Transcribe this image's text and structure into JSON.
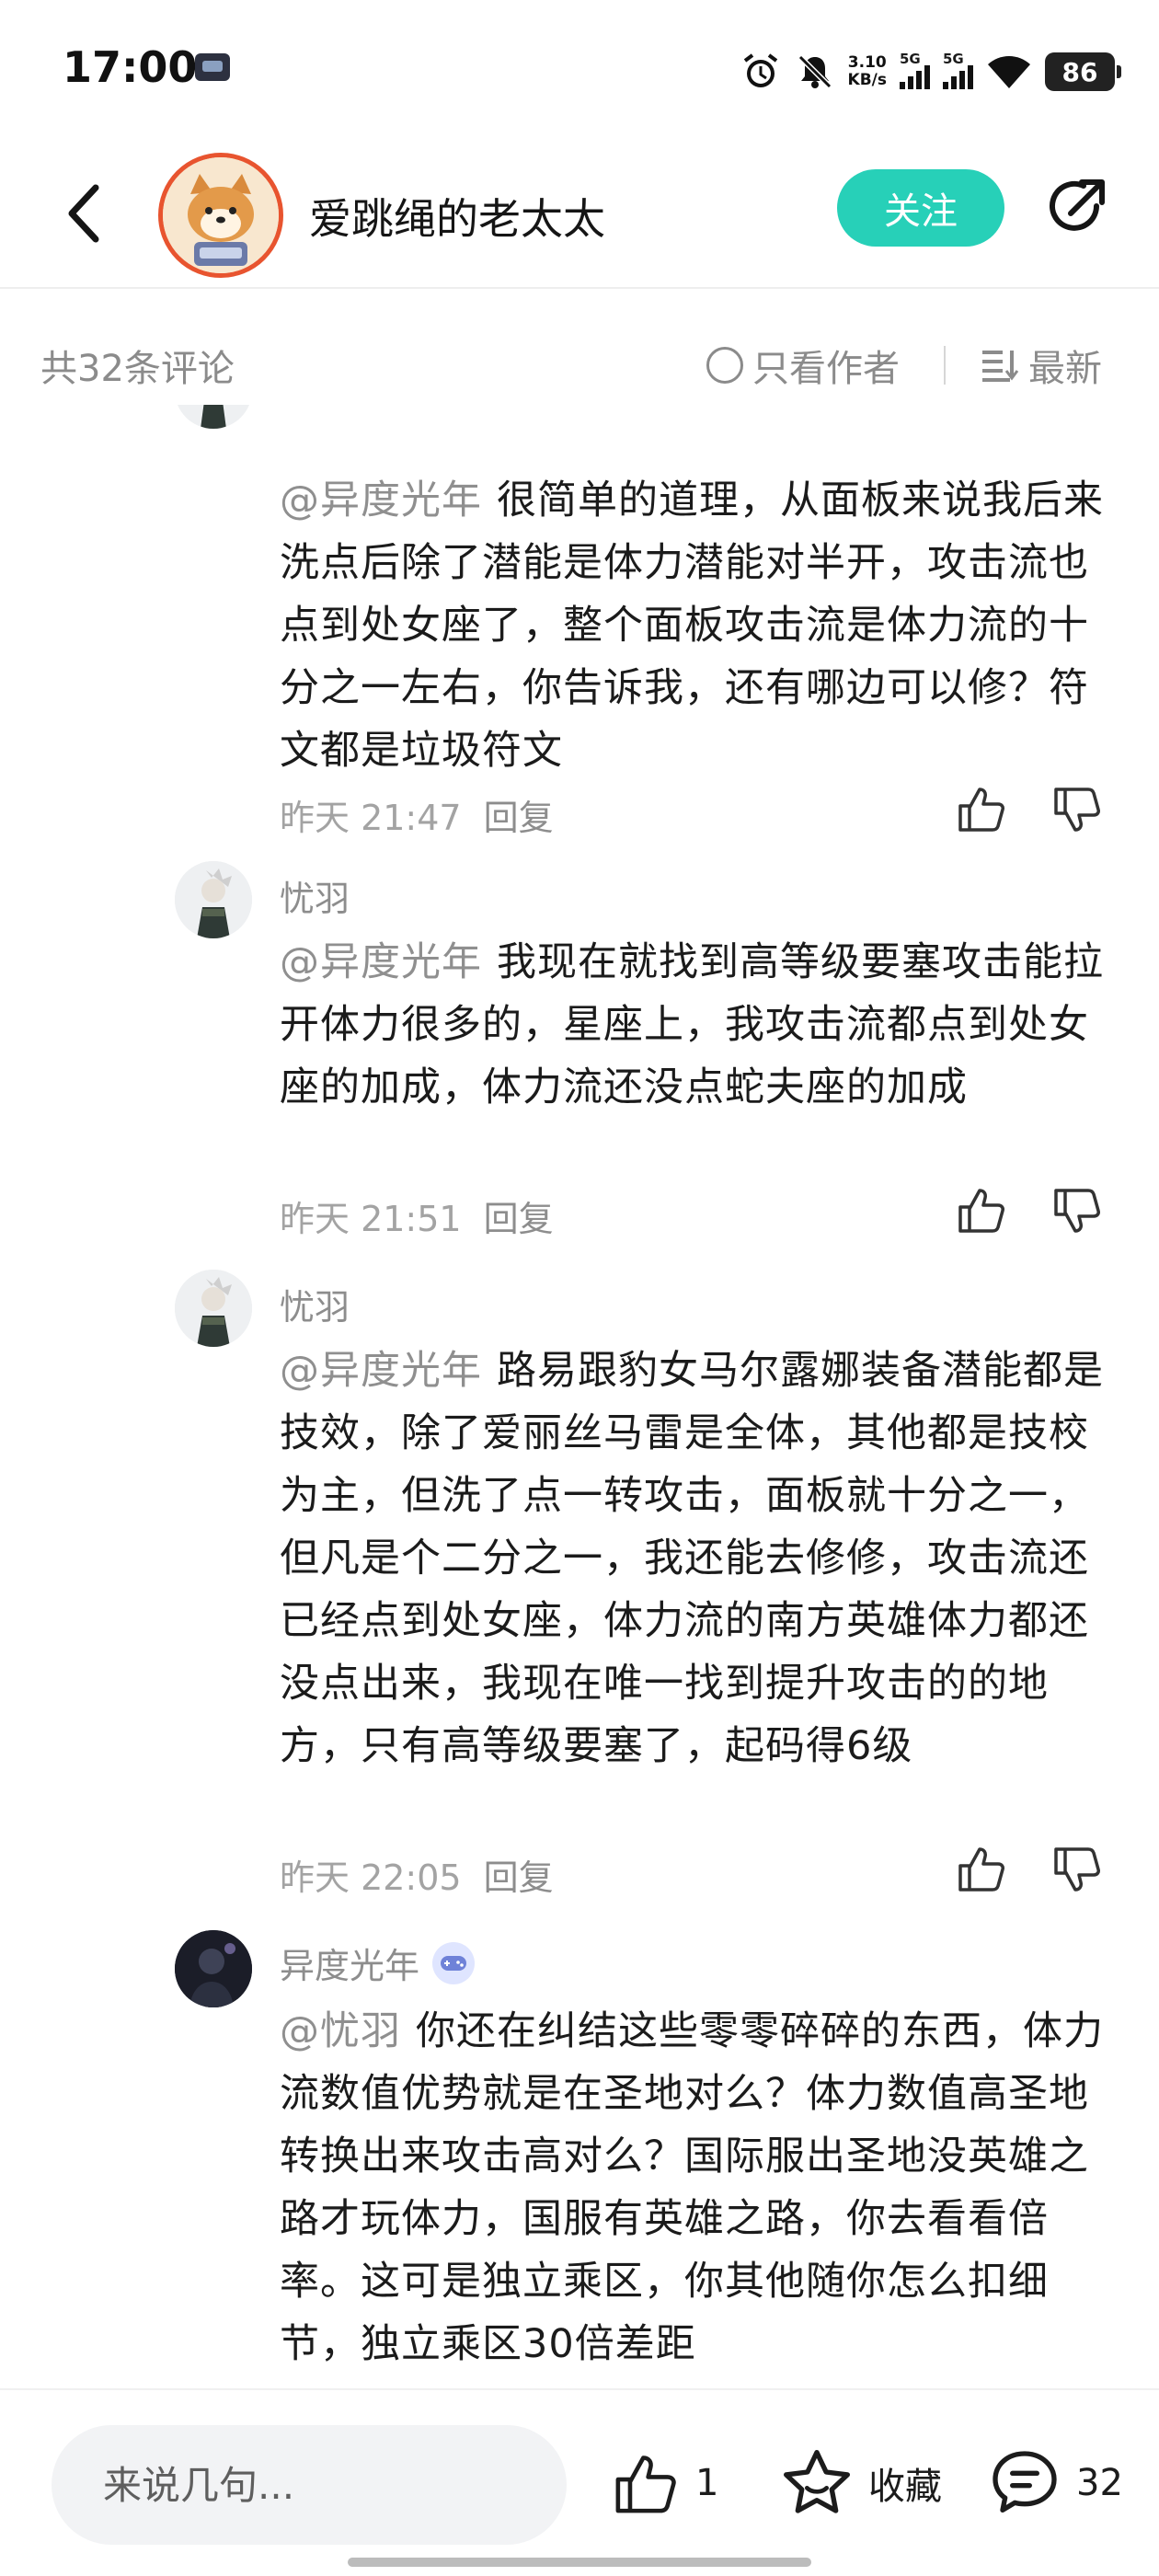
{
  "status_bar": {
    "time": "17:00",
    "net_speed_value": "3.10",
    "net_speed_unit": "KB/s",
    "signal_1_label": "5G",
    "signal_2_label": "5G",
    "battery": "86"
  },
  "header": {
    "title": "爱跳绳的老太太",
    "follow_label": "关注"
  },
  "filter": {
    "count_text": "共32条评论",
    "author_only_label": "只看作者",
    "sort_label": "最新"
  },
  "comments": [
    {
      "name": "",
      "mention": "@异度光年",
      "text": "很简单的道理，从面板来说我后来洗点后除了潜能是体力潜能对半开，攻击流也点到处女座了，整个面板攻击流是体力流的十分之一左右，你告诉我，还有哪边可以修？符文都是垃圾符文",
      "time": "昨天 21:47",
      "reply_label": "回复"
    },
    {
      "name": "忧羽",
      "mention": "@异度光年",
      "text": "我现在就找到高等级要塞攻击能拉开体力很多的，星座上，我攻击流都点到处女座的加成，体力流还没点蛇夫座的加成",
      "time": "昨天 21:51",
      "reply_label": "回复"
    },
    {
      "name": "忧羽",
      "mention": "@异度光年",
      "text": "路易跟豹女马尔露娜装备潜能都是技效，除了爱丽丝马雷是全体，其他都是技校为主，但洗了点一转攻击，面板就十分之一，但凡是个二分之一，我还能去修修，攻击流还已经点到处女座，体力流的南方英雄体力都还没点出来，我现在唯一找到提升攻击的的地方，只有高等级要塞了，起码得6级",
      "time": "昨天 22:05",
      "reply_label": "回复"
    },
    {
      "name": "异度光年",
      "mention": "@忧羽",
      "text": "你还在纠结这些零零碎碎的东西，体力流数值优势就是在圣地对么？体力数值高圣地转换出来攻击高对么？国际服出圣地没英雄之路才玩体力，国服有英雄之路，你去看看倍率。这可是独立乘区，你其他随你怎么扣细节，独立乘区30倍差距"
    }
  ],
  "bottom_bar": {
    "input_placeholder": "来说几句...",
    "like_count": "1",
    "favorite_label": "收藏",
    "comment_count": "32"
  },
  "colors": {
    "accent": "#27d0b8",
    "muted_text": "#8d8d8d",
    "body_text": "#1b1b1b"
  }
}
